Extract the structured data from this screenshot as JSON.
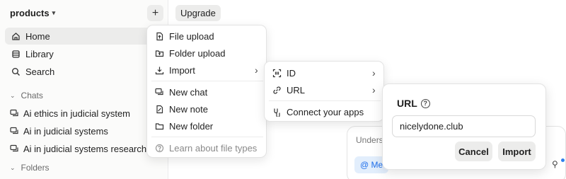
{
  "workspace": {
    "name": "products"
  },
  "sidebar": {
    "nav": [
      {
        "label": "Home",
        "icon": "home-icon",
        "active": true
      },
      {
        "label": "Library",
        "icon": "library-icon"
      },
      {
        "label": "Search",
        "icon": "search-icon"
      }
    ],
    "chats_header": "Chats",
    "chats": [
      "Ai ethics in judicial system",
      "Ai in judicial systems",
      "Ai in judicial systems research"
    ],
    "folders_header": "Folders"
  },
  "topbar": {
    "upgrade_label": "Upgrade"
  },
  "add_menu": {
    "items": [
      {
        "label": "File upload",
        "icon": "file-upload-icon"
      },
      {
        "label": "Folder upload",
        "icon": "folder-upload-icon"
      },
      {
        "label": "Import",
        "icon": "import-icon",
        "submenu": true
      },
      {
        "label": "New chat",
        "icon": "new-chat-icon"
      },
      {
        "label": "New note",
        "icon": "new-note-icon"
      },
      {
        "label": "New folder",
        "icon": "new-folder-icon"
      },
      {
        "label": "Learn about file types",
        "icon": "help-icon",
        "muted": true
      }
    ]
  },
  "import_menu": {
    "items": [
      {
        "label": "ID",
        "icon": "id-scan-icon",
        "submenu": true
      },
      {
        "label": "URL",
        "icon": "link-icon",
        "submenu": true
      },
      {
        "label": "Connect your apps",
        "icon": "connect-apps-icon"
      }
    ]
  },
  "url_popover": {
    "title": "URL",
    "value": "nicelydone.club",
    "cancel_label": "Cancel",
    "import_label": "Import"
  },
  "composer": {
    "placeholder_fragment": "Unders",
    "mention_fragment": "@ Me"
  }
}
